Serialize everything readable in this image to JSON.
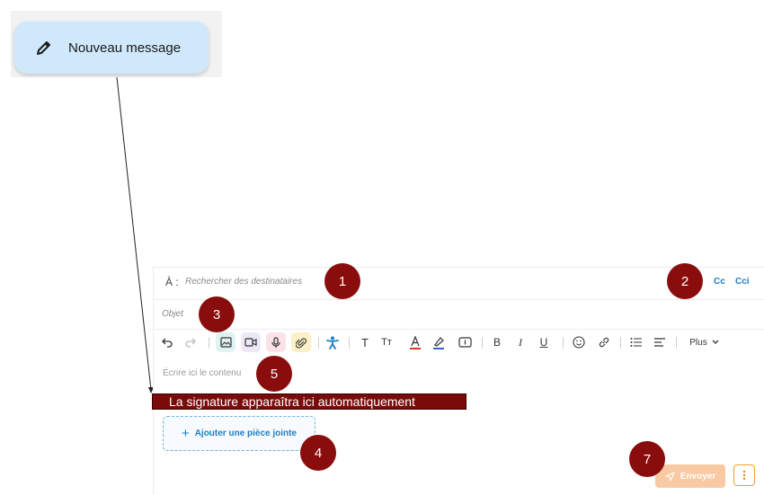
{
  "new_message_button": {
    "label": "Nouveau message",
    "icon": "pencil-icon"
  },
  "compose": {
    "to_label": "À :",
    "to_placeholder": "Rechercher des destinataires",
    "cc_label": "Cc",
    "bcc_label": "Cci",
    "subject_placeholder": "Objet",
    "body_placeholder": "Écrire ici le contenu",
    "signature_text": "La signature apparaîtra ici automatiquement",
    "attach_label": "Ajouter une pièce jointe",
    "send_label": "Envoyer",
    "toolbar": {
      "more_label": "Plus",
      "text_label": "T",
      "text_size_label": "Tт",
      "bold_label": "B",
      "italic_label": "I",
      "underline_label": "U"
    }
  },
  "markers": {
    "m1": "1",
    "m2": "2",
    "m3": "3",
    "m4": "4",
    "m5": "5",
    "m7": "7"
  },
  "colors": {
    "marker": "#8a0d0d",
    "accent_blue": "#1a7fc4",
    "send_disabled": "#f8c9a3",
    "new_message_bg": "#cfe9fb"
  }
}
